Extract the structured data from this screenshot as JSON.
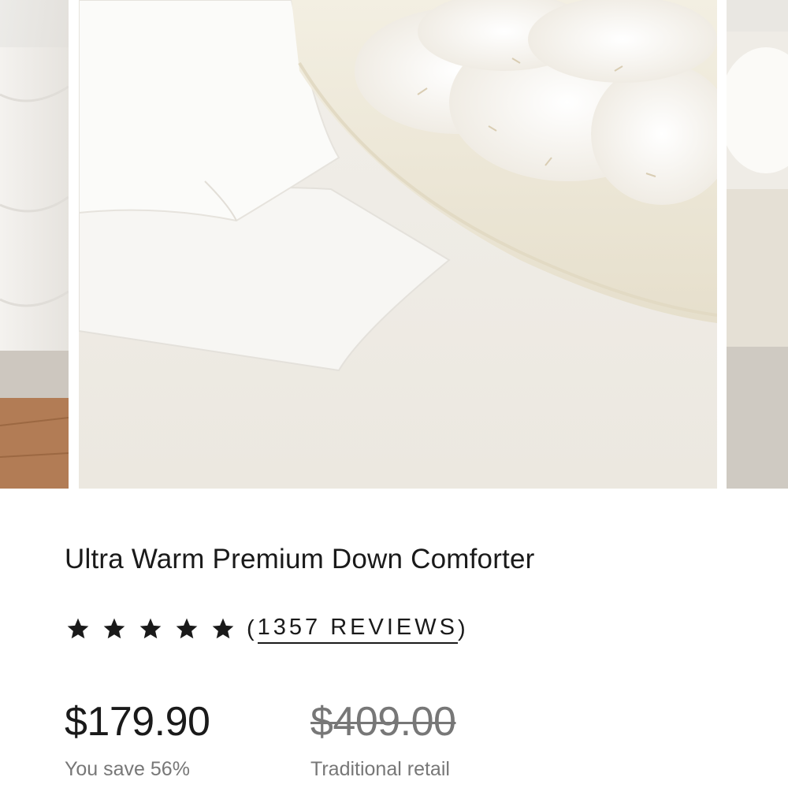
{
  "product": {
    "title": "Ultra Warm Premium Down Comforter",
    "rating": {
      "stars": 5,
      "max_stars": 5,
      "review_count_label": "1357 REVIEWS",
      "open_paren": "(",
      "close_paren": ")"
    },
    "price": {
      "sale": "$179.90",
      "savings_label": "You save 56%",
      "retail": "$409.00",
      "retail_label": "Traditional retail"
    }
  },
  "gallery": {
    "images": [
      {
        "description": "partial white comforter on bed"
      },
      {
        "description": "folded white down comforter next to bowl of down clusters"
      },
      {
        "description": "partial bowl of down"
      }
    ]
  },
  "colors": {
    "text_primary": "#1a1a1a",
    "text_muted": "#777777",
    "star": "#1a1a1a"
  },
  "icons": {
    "rating": "star-icon"
  }
}
